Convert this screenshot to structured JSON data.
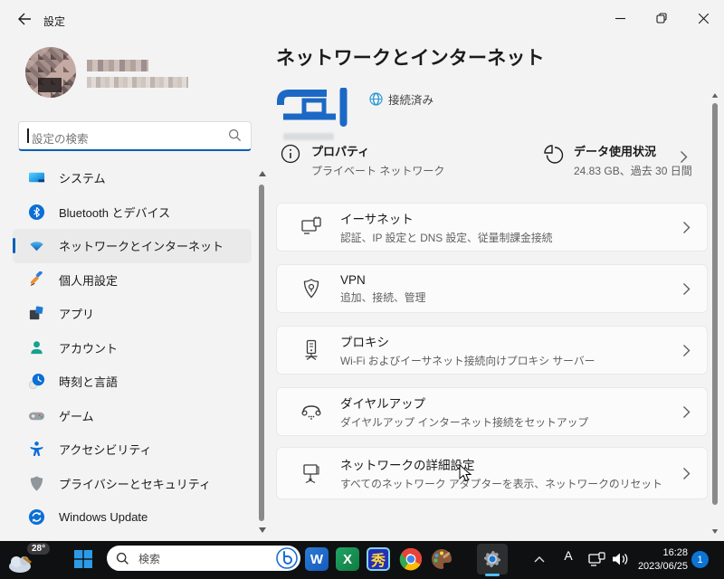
{
  "titlebar": {
    "title": "設定"
  },
  "sidebar": {
    "search": {
      "placeholder": "設定の検索"
    },
    "items": [
      {
        "label": "システム"
      },
      {
        "label": "Bluetooth とデバイス"
      },
      {
        "label": "ネットワークとインターネット",
        "selected": true
      },
      {
        "label": "個人用設定"
      },
      {
        "label": "アプリ"
      },
      {
        "label": "アカウント"
      },
      {
        "label": "時刻と言語"
      },
      {
        "label": "ゲーム"
      },
      {
        "label": "アクセシビリティ"
      },
      {
        "label": "プライバシーとセキュリティ"
      },
      {
        "label": "Windows Update"
      }
    ]
  },
  "main": {
    "page_title": "ネットワークとインターネット",
    "hero": {
      "status": "接続済み"
    },
    "properties": {
      "title": "プロパティ",
      "subtitle": "プライベート ネットワーク"
    },
    "data_usage": {
      "title": "データ使用状況",
      "subtitle": "24.83 GB、過去 30 日間"
    },
    "cards": [
      {
        "title": "イーサネット",
        "subtitle": "認証、IP 設定と DNS 設定、従量制課金接続"
      },
      {
        "title": "VPN",
        "subtitle": "追加、接続、管理"
      },
      {
        "title": "プロキシ",
        "subtitle": "Wi-Fi およびイーサネット接続向けプロキシ サーバー"
      },
      {
        "title": "ダイヤルアップ",
        "subtitle": "ダイヤルアップ インターネット接続をセットアップ"
      },
      {
        "title": "ネットワークの詳細設定",
        "subtitle": "すべてのネットワーク アダプターを表示、ネットワークのリセット"
      }
    ]
  },
  "taskbar": {
    "weather_temp": "28°",
    "search_placeholder": "検索",
    "word_letter": "W",
    "excel_letter": "X",
    "hidemaru_char": "秀",
    "ime_mode": "A",
    "time": "16:28",
    "date": "2023/06/25",
    "badge_count": "1"
  },
  "colors": {
    "accent": "#005fb8",
    "hero_blue": "#1c68c5",
    "taskbar_bg": "#0f1011",
    "card_bg": "#fbfbfb",
    "badge_blue": "#0b74d4"
  }
}
